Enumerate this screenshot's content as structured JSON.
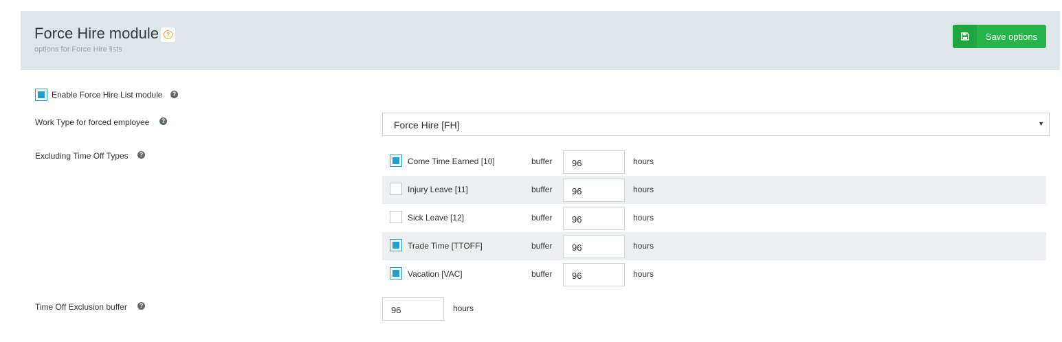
{
  "header": {
    "title": "Force Hire module",
    "subtitle": "options for Force Hire lists",
    "save_label": "Save options"
  },
  "enable_module": {
    "label": "Enable Force Hire List module",
    "checked": true
  },
  "work_type": {
    "label": "Work Type for forced employee",
    "selected": "Force Hire [FH]"
  },
  "excluding": {
    "label": "Excluding Time Off Types",
    "buffer_label": "buffer",
    "hours_label": "hours",
    "items": [
      {
        "name": "Come Time Earned [10]",
        "checked": true,
        "buffer": "96"
      },
      {
        "name": "Injury Leave [11]",
        "checked": false,
        "buffer": "96"
      },
      {
        "name": "Sick Leave [12]",
        "checked": false,
        "buffer": "96"
      },
      {
        "name": "Trade Time [TTOFF]",
        "checked": true,
        "buffer": "96"
      },
      {
        "name": "Vacation [VAC]",
        "checked": true,
        "buffer": "96"
      }
    ]
  },
  "exclusion_buffer": {
    "label": "Time Off Exclusion buffer",
    "value": "96",
    "unit": "hours"
  },
  "colors": {
    "header_bg": "#dfe6e9",
    "save_button": "#27b54b",
    "checkbox_accent": "#1ea0d7",
    "help_icon_title": "#f0a23a"
  }
}
